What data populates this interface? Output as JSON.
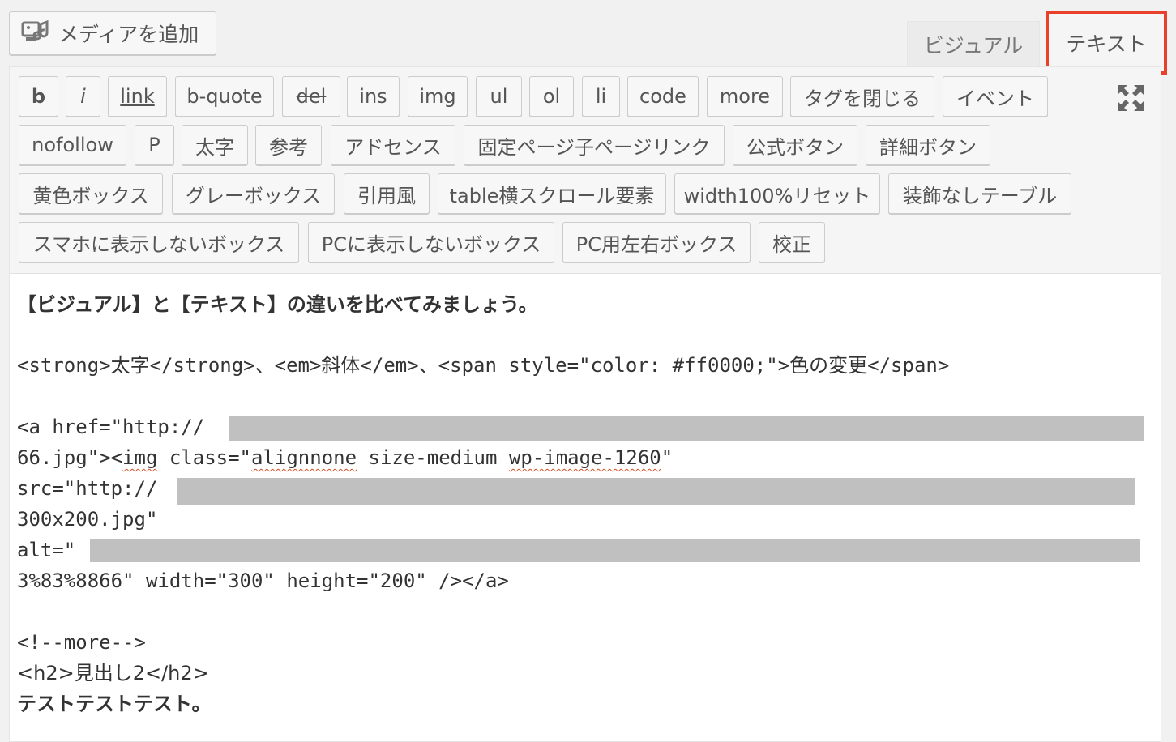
{
  "media_button": {
    "label": "メディアを追加",
    "icon": "media-add-icon"
  },
  "tabs": {
    "visual": "ビジュアル",
    "text": "テキスト",
    "highlight_color": "#e8402a"
  },
  "toolbar": {
    "rows": [
      [
        "b",
        "i",
        "link",
        "b-quote",
        "del",
        "ins",
        "img",
        "ul",
        "ol",
        "li",
        "code",
        "more",
        "タグを閉じる",
        "イベント"
      ],
      [
        "nofollow",
        "P",
        "太字",
        "参考",
        "アドセンス",
        "固定ページ子ページリンク",
        "公式ボタン",
        "詳細ボタン"
      ],
      [
        "黄色ボックス",
        "グレーボックス",
        "引用風",
        "table横スクロール要素",
        "width100%リセット",
        "装飾なしテーブル"
      ],
      [
        "スマホに表示しないボックス",
        "PCに表示しないボックス",
        "PC用左右ボックス",
        "校正"
      ]
    ],
    "fullscreen_icon": "fullscreen-icon"
  },
  "content": {
    "line1": "【ビジュアル】と【テキスト】の違いを比べてみましょう。",
    "line2": "<strong>太字</strong>、<em>斜体</em>、<span style=\"color: #ff0000;\">色の変更</span>",
    "line3": "<a href=\"http://",
    "line4a": "66.jpg\"><",
    "line4b": "img",
    "line4c": " class=\"",
    "line4d": "alignnone",
    "line4e": " size-medium ",
    "line4f": "wp-image-1260",
    "line4g": "\"",
    "line5": "src=\"http://",
    "line6": "300x200.jpg\"",
    "line7": "alt=\"",
    "line8": "3%83%8866\" width=\"300\" height=\"200\" /></a>",
    "line9": "<!--more-->",
    "line10": "<h2>見出し2</h2>",
    "line11": "テストテストテスト。"
  }
}
